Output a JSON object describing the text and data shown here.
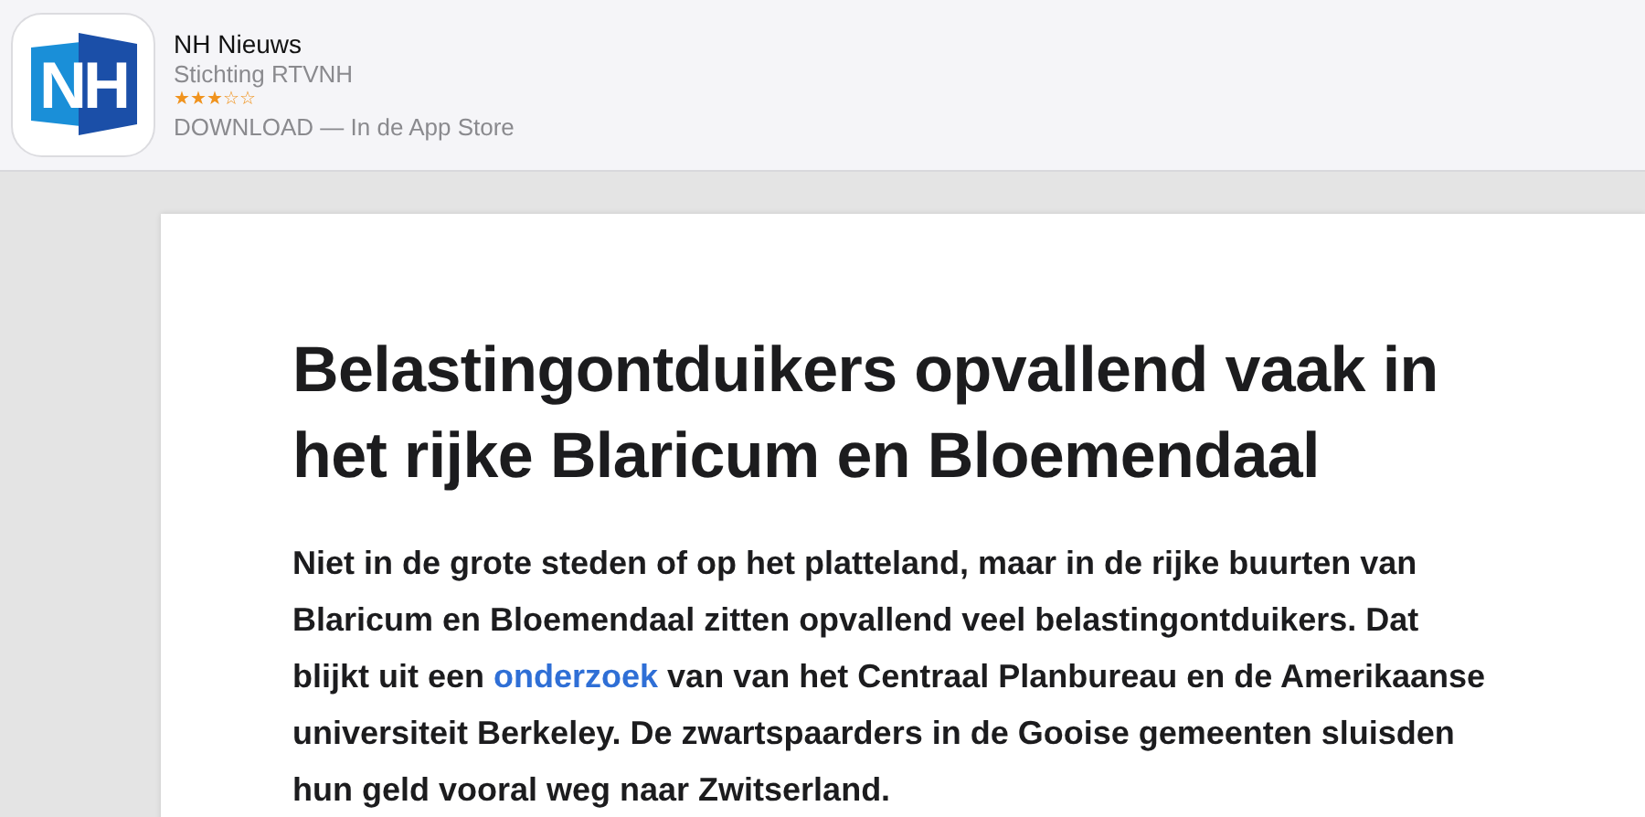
{
  "app_banner": {
    "name": "NH Nieuws",
    "publisher": "Stichting RTVNH",
    "stars": 3,
    "icon_text": "NH",
    "action": "DOWNLOAD — In de App Store"
  },
  "article": {
    "title": "Belastingontduikers opvallend vaak in het rijke Blaricum en Bloemendaal",
    "intro": {
      "before": "Niet in de grote steden of op het platteland, maar in de rijke buurten van Blaricum en Bloemendaal zitten opvallend veel belastingontduikers. Dat blijkt uit een ",
      "link": "onderzoek",
      "after": " van van het Centraal Planbureau en de Amerikaanse universiteit Berkeley. De zwartspaarders in de Gooise gemeenten sluisden hun geld vooral weg naar Zwitserland."
    }
  }
}
